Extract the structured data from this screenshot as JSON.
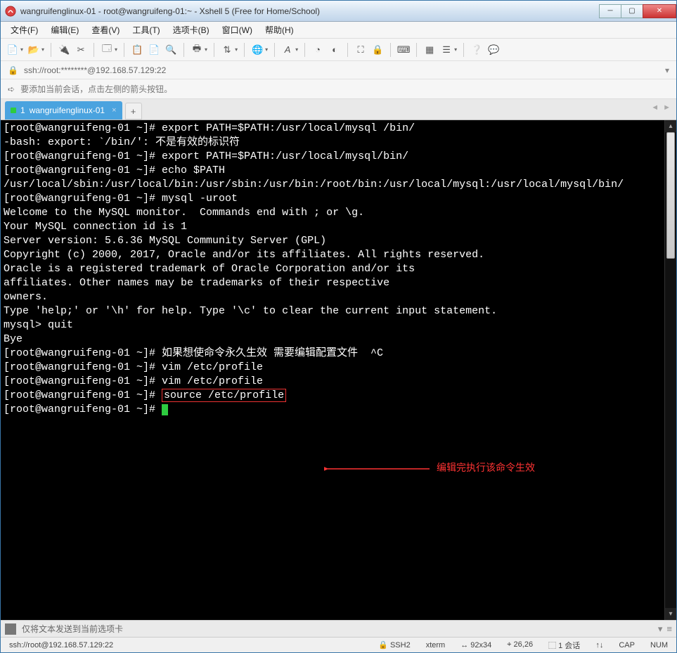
{
  "window": {
    "title": "wangruifenglinux-01 - root@wangruifeng-01:~ - Xshell 5 (Free for Home/School)"
  },
  "menu": {
    "file": "文件(F)",
    "edit": "编辑(E)",
    "view": "查看(V)",
    "tools": "工具(T)",
    "tab": "选项卡(B)",
    "window": "窗口(W)",
    "help": "帮助(H)"
  },
  "address": {
    "url": "ssh://root:********@192.168.57.129:22"
  },
  "hint": {
    "text": "要添加当前会话，点击左侧的箭头按钮。"
  },
  "tab": {
    "index": "1",
    "name": "wangruifenglinux-01"
  },
  "terminal": {
    "lines": [
      "[root@wangruifeng-01 ~]# export PATH=$PATH:/usr/local/mysql /bin/",
      "-bash: export: `/bin/': 不是有效的标识符",
      "[root@wangruifeng-01 ~]# export PATH=$PATH:/usr/local/mysql/bin/",
      "[root@wangruifeng-01 ~]# echo $PATH",
      "/usr/local/sbin:/usr/local/bin:/usr/sbin:/usr/bin:/root/bin:/usr/local/mysql:/usr/local/mysql/bin/",
      "[root@wangruifeng-01 ~]# mysql -uroot",
      "Welcome to the MySQL monitor.  Commands end with ; or \\g.",
      "Your MySQL connection id is 1",
      "Server version: 5.6.36 MySQL Community Server (GPL)",
      "",
      "Copyright (c) 2000, 2017, Oracle and/or its affiliates. All rights reserved.",
      "",
      "Oracle is a registered trademark of Oracle Corporation and/or its",
      "affiliates. Other names may be trademarks of their respective",
      "owners.",
      "",
      "Type 'help;' or '\\h' for help. Type '\\c' to clear the current input statement.",
      "",
      "mysql> quit",
      "Bye",
      "[root@wangruifeng-01 ~]# 如果想使命令永久生效 需要编辑配置文件  ^C",
      "[root@wangruifeng-01 ~]# vim /etc/profile",
      "[root@wangruifeng-01 ~]# vim /etc/profile"
    ],
    "boxed_prompt": "[root@wangruifeng-01 ~]# ",
    "boxed_cmd": "source /etc/profile",
    "last_prompt": "[root@wangruifeng-01 ~]# ",
    "annotation": "编辑完执行该命令生效"
  },
  "sendbar": {
    "text": "仅将文本发送到当前选项卡"
  },
  "status": {
    "conn": "ssh://root@192.168.57.129:22",
    "ssh": "SSH2",
    "term": "xterm",
    "size": "92x34",
    "pos": "26,26",
    "sessions": "1 会话",
    "cap": "CAP",
    "num": "NUM"
  },
  "icons": {
    "lock": "🔒",
    "size_icon": "↔",
    "pos_icon": "⌖",
    "sessions_icon": "⬚",
    "net_up": "↑",
    "net_dn": "↓"
  }
}
